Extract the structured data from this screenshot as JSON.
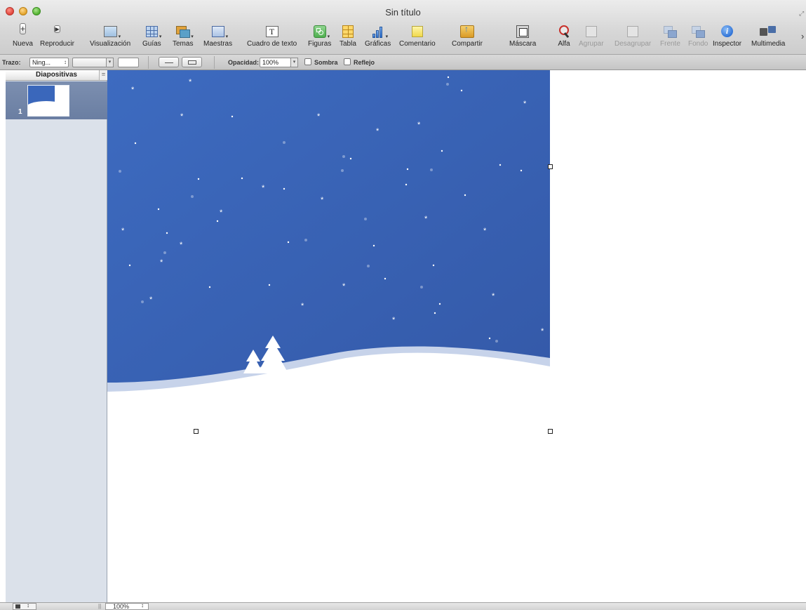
{
  "window": {
    "title": "Sin título",
    "fullscreen_glyph": "⤢"
  },
  "toolbar": {
    "items": [
      {
        "id": "nueva",
        "label": "Nueva",
        "icon": "plus-icon"
      },
      {
        "id": "reproducir",
        "label": "Reproducir",
        "icon": "play-icon"
      },
      {
        "id": "visualizacion",
        "label": "Visualización",
        "icon": "view-icon"
      },
      {
        "id": "guias",
        "label": "Guías",
        "icon": "grid-icon"
      },
      {
        "id": "temas",
        "label": "Temas",
        "icon": "themes-icon"
      },
      {
        "id": "maestras",
        "label": "Maestras",
        "icon": "masters-icon"
      },
      {
        "id": "cuadro_texto",
        "label": "Cuadro de texto",
        "icon": "text-box-icon"
      },
      {
        "id": "figuras",
        "label": "Figuras",
        "icon": "shapes-icon"
      },
      {
        "id": "tabla",
        "label": "Tabla",
        "icon": "table-icon"
      },
      {
        "id": "graficas",
        "label": "Gráficas",
        "icon": "chart-icon"
      },
      {
        "id": "comentario",
        "label": "Comentario",
        "icon": "comment-icon"
      },
      {
        "id": "compartir",
        "label": "Compartir",
        "icon": "share-icon"
      },
      {
        "id": "mascara",
        "label": "Máscara",
        "icon": "mask-icon"
      },
      {
        "id": "alfa",
        "label": "Alfa",
        "icon": "alpha-icon"
      },
      {
        "id": "agrupar",
        "label": "Agrupar",
        "icon": "group-icon",
        "disabled": true
      },
      {
        "id": "desagrupar",
        "label": "Desagrupar",
        "icon": "ungroup-icon",
        "disabled": true
      },
      {
        "id": "frente",
        "label": "Frente",
        "icon": "front-icon",
        "disabled": true
      },
      {
        "id": "fondo",
        "label": "Fondo",
        "icon": "back-icon",
        "disabled": true
      },
      {
        "id": "inspector",
        "label": "Inspector",
        "icon": "info-icon"
      },
      {
        "id": "multimedia",
        "label": "Multimedia",
        "icon": "media-icon"
      }
    ],
    "text_icon_glyph": "T",
    "plus_glyph": "+",
    "play_glyph": "▶",
    "info_glyph": "i",
    "more_glyph": "›",
    "caret_glyph": "▾"
  },
  "format_bar": {
    "stroke_label": "Trazo:",
    "stroke_value": "Ning...",
    "opacity_label": "Opacidad:",
    "opacity_value": "100%",
    "shadow_label": "Sombra",
    "reflection_label": "Reflejo",
    "stepper_glyph": "↕",
    "dropdown_glyph": "▾"
  },
  "sidebar": {
    "header": "Diapositivas",
    "header_btn_glyph": "=",
    "slides": [
      {
        "number": "1"
      }
    ]
  },
  "status": {
    "zoom": "100%",
    "stepper_glyph": "↕",
    "grip_glyph": "||"
  },
  "colors": {
    "sky_top": "#3d6bc0",
    "sky_bottom": "#3459a8",
    "snow": "#ffffff",
    "hill_shadow": "#c7d3ea",
    "selected_slide": "#7185a8"
  }
}
